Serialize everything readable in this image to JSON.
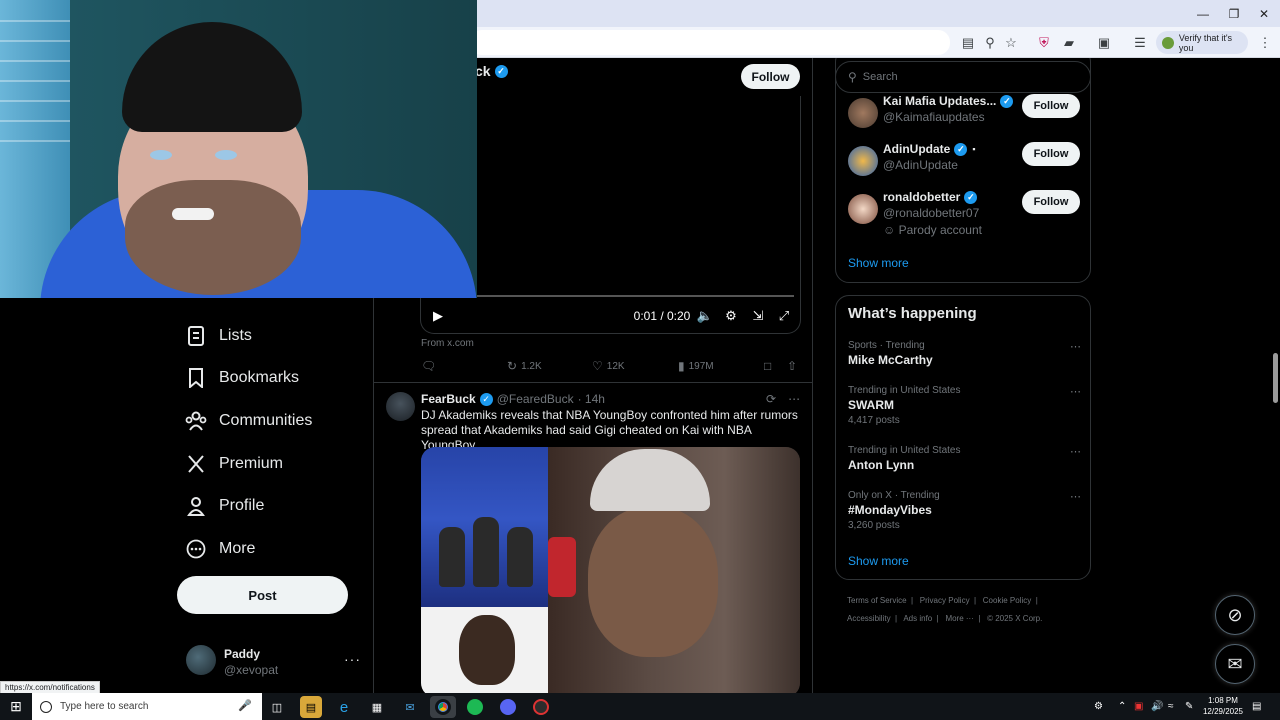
{
  "browser": {
    "verify_label": "Verify that it's you",
    "window_controls": [
      "minimize-icon",
      "restore-icon",
      "close-icon"
    ],
    "toolbar_icons": [
      "install-icon",
      "zoom-icon",
      "star-icon",
      "shield-extension-icon",
      "extensions-icon",
      "tab-search-icon",
      "reading-list-icon"
    ]
  },
  "nav": {
    "items": [
      {
        "label": "Lists",
        "icon": "lists-icon"
      },
      {
        "label": "Bookmarks",
        "icon": "bookmark-icon"
      },
      {
        "label": "Communities",
        "icon": "communities-icon"
      },
      {
        "label": "Premium",
        "icon": "x-logo-icon"
      },
      {
        "label": "Profile",
        "icon": "profile-icon"
      },
      {
        "label": "More",
        "icon": "more-circle-icon"
      }
    ],
    "post_label": "Post",
    "account": {
      "name": "Paddy",
      "handle": "@xevopat",
      "menu": "···"
    }
  },
  "timeline": {
    "top_tweet": {
      "author_partial": "ck",
      "follow_label": "Follow",
      "video_time": "0:01 / 0:20",
      "source": "From x.com",
      "stats": {
        "reposts": "1.2K",
        "likes": "12K",
        "views": "197M"
      }
    },
    "tweet": {
      "name": "FearBuck",
      "handle": "@FearedBuck",
      "time": "· 14h",
      "text": "DJ Akademiks reveals that NBA YoungBoy confronted him after rumors spread that Akademiks had said Gigi cheated on Kai with NBA YoungBoy"
    }
  },
  "right": {
    "search_placeholder": "Search",
    "who_to_follow": [
      {
        "name": "Kai Mafia Updates...",
        "handle": "@Kaimafiaupdates",
        "follow": "Follow"
      },
      {
        "name": "AdinUpdate",
        "handle": "@AdinUpdate",
        "follow": "Follow"
      },
      {
        "name": "ronaldobetter",
        "handle": "@ronaldobetter07",
        "follow": "Follow",
        "parody": "Parody account"
      }
    ],
    "show_more": "Show more",
    "whats_happening": {
      "title": "What’s happening",
      "trends": [
        {
          "context": "Sports · Trending",
          "topic": "Mike McCarthy",
          "posts": ""
        },
        {
          "context": "Trending in United States",
          "topic": "SWARM",
          "posts": "4,417 posts"
        },
        {
          "context": "Trending in United States",
          "topic": "Anton Lynn",
          "posts": ""
        },
        {
          "context": "Only on X · Trending",
          "topic": "#MondayVibes",
          "posts": "3,260 posts"
        }
      ],
      "show_more": "Show more"
    },
    "footer": {
      "line1": [
        "Terms of Service",
        "Privacy Policy",
        "Cookie Policy"
      ],
      "line2": [
        "Accessibility",
        "Ads info",
        "More ···",
        "© 2025 X Corp."
      ]
    }
  },
  "status_link": "https://x.com/notifications",
  "taskbar": {
    "search_placeholder": "Type here to search",
    "apps": [
      "task-view-icon",
      "file-explorer-icon",
      "edge-icon",
      "store-icon",
      "mail-icon",
      "chrome-icon",
      "spotify-icon",
      "discord-icon",
      "app-icon"
    ],
    "time": "1:08 PM",
    "date": "12/29/2025"
  },
  "colors": {
    "accent": "#1d9bf0",
    "background": "#000000",
    "border": "#2f3336"
  }
}
